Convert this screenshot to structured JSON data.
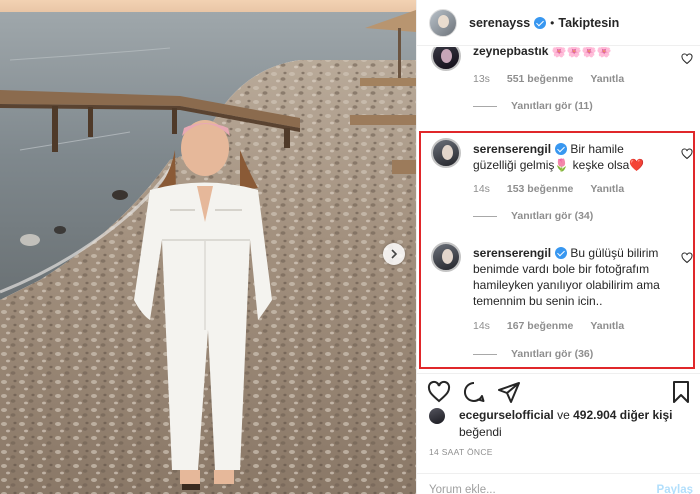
{
  "header": {
    "username": "serenayss",
    "separator": "•",
    "follow_status": "Takiptesin"
  },
  "comments": [
    {
      "username": "zeynepbastık",
      "text": "🌸🌸🌸🌸",
      "time": "13s",
      "likes": "551 beğenme",
      "reply": "Yanıtla",
      "view_replies": "Yanıtları gör (11)"
    },
    {
      "username": "serenserengil",
      "text": "Bir hamile güzelliği gelmiş🌷 keşke olsa❤️",
      "time": "14s",
      "likes": "153 beğenme",
      "reply": "Yanıtla",
      "view_replies": "Yanıtları gör (34)"
    },
    {
      "username": "serenserengil",
      "text": "Bu gülüşü bilirim benimde vardı bole bir fotoğrafım hamileyken yanılıyor olabilirim ama temennim bu senin icin..",
      "time": "14s",
      "likes": "167 beğenme",
      "reply": "Yanıtla",
      "view_replies": "Yanıtları gör (36)"
    }
  ],
  "likes_line": {
    "user": "ecegurselofficial",
    "connector": "ve",
    "others": "492.904 diğer kişi",
    "suffix": "beğendi"
  },
  "timestamp": "14 SAAT ÖNCE",
  "comment_input": {
    "placeholder": "Yorum ekle...",
    "post_label": "Paylaş"
  },
  "colors": {
    "accent": "#3897f0",
    "highlight": "#e0272a",
    "muted": "#8e8e8e"
  },
  "icons": [
    "heart-icon",
    "comment-icon",
    "share-icon",
    "bookmark-icon",
    "verified-icon",
    "chevron-right-icon"
  ]
}
